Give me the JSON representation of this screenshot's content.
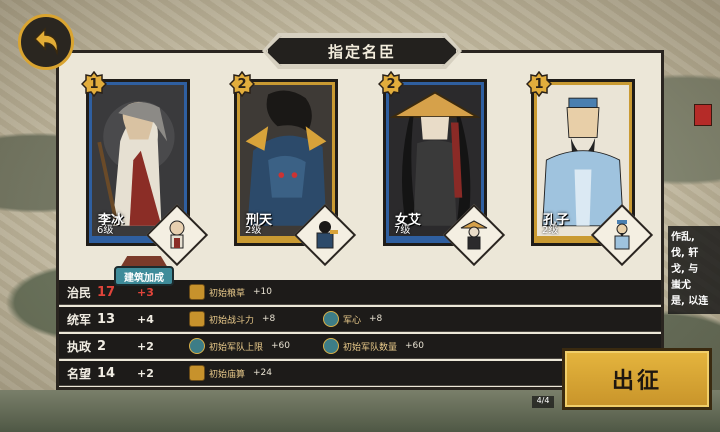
{
  "title": "指定名臣",
  "heroes": [
    {
      "badge": "1",
      "name": "李冰",
      "level": "6级",
      "frame": "blue"
    },
    {
      "badge": "2",
      "name": "刑天",
      "level": "2级",
      "frame": "gold"
    },
    {
      "badge": "2",
      "name": "女艾",
      "level": "7级",
      "frame": "blue"
    },
    {
      "badge": "1",
      "name": "孔子",
      "level": "2级",
      "frame": "gold"
    }
  ],
  "bonus_tag": "建筑加成",
  "stats": [
    {
      "name": "治民",
      "value": "17",
      "bonus": "+3",
      "value_red": true,
      "effects": [
        {
          "icon": "grain-icon",
          "name": "初始粮草",
          "value": "+10"
        }
      ]
    },
    {
      "name": "统军",
      "value": "13",
      "bonus": "+4",
      "value_red": false,
      "effects": [
        {
          "icon": "fist-icon",
          "name": "初始战斗力",
          "value": "+8"
        },
        {
          "icon": "helmet-icon",
          "name": "军心",
          "value": "+8"
        }
      ]
    },
    {
      "name": "执政",
      "value": "2",
      "bonus": "+2",
      "value_red": false,
      "effects": [
        {
          "icon": "soldier-icon",
          "name": "初始军队上限",
          "value": "+60"
        },
        {
          "icon": "soldier-icon",
          "name": "初始军队数量",
          "value": "+60"
        }
      ]
    },
    {
      "name": "名望",
      "value": "14",
      "bonus": "+2",
      "value_red": false,
      "effects": [
        {
          "icon": "temple-icon",
          "name": "初始庙算",
          "value": "+24"
        }
      ]
    }
  ],
  "side_text": [
    "作乱,",
    "伐, 轩",
    "戈, 与",
    "蚩尤",
    "是, 以连"
  ],
  "march_button": "出征",
  "page_indicator": "4/4"
}
